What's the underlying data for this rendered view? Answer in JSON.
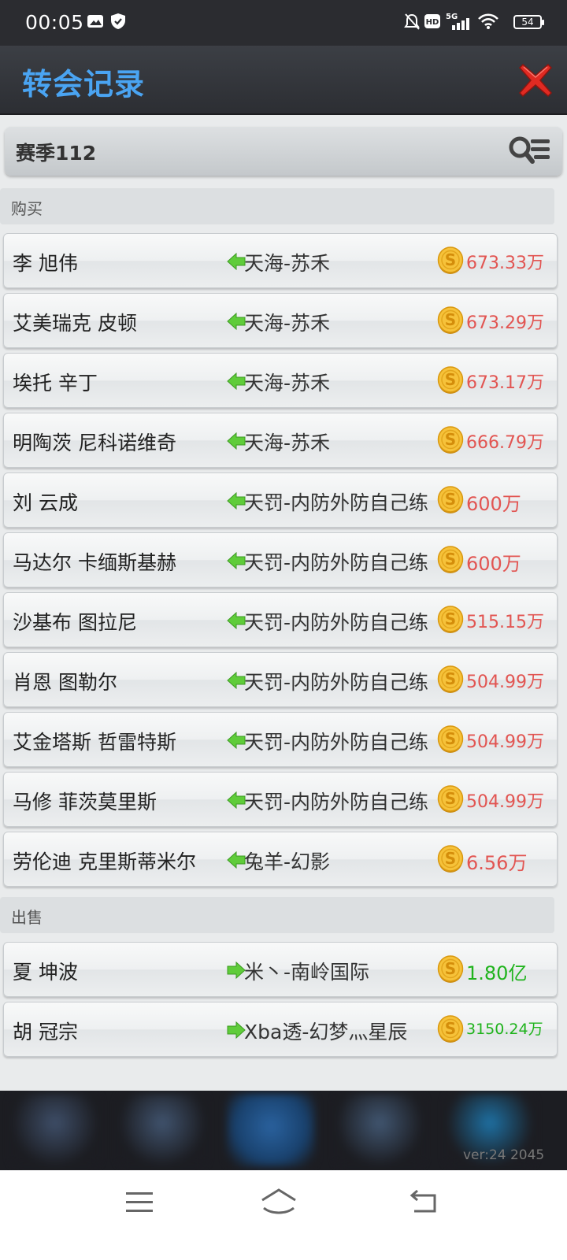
{
  "status_bar": {
    "time": "00:05",
    "battery": "54"
  },
  "header": {
    "title": "转会记录"
  },
  "season": {
    "label": "赛季112"
  },
  "buy_section": {
    "label": "购买",
    "rows": [
      {
        "player": "李 旭伟",
        "team": "天海-苏禾",
        "price": "673.33万"
      },
      {
        "player": "艾美瑞克 皮顿",
        "team": "天海-苏禾",
        "price": "673.29万"
      },
      {
        "player": "埃托 辛丁",
        "team": "天海-苏禾",
        "price": "673.17万"
      },
      {
        "player": "明陶茨 尼科诺维奇",
        "team": "天海-苏禾",
        "price": "666.79万"
      },
      {
        "player": "刘 云成",
        "team": "天罚-内防外防自己练",
        "price": "600万"
      },
      {
        "player": "马达尔 卡缅斯基赫",
        "team": "天罚-内防外防自己练",
        "price": "600万"
      },
      {
        "player": "沙基布 图拉尼",
        "team": "天罚-内防外防自己练",
        "price": "515.15万"
      },
      {
        "player": "肖恩 图勒尔",
        "team": "天罚-内防外防自己练",
        "price": "504.99万"
      },
      {
        "player": "艾金塔斯 哲雷特斯",
        "team": "天罚-内防外防自己练",
        "price": "504.99万"
      },
      {
        "player": "马修 菲茨莫里斯",
        "team": "天罚-内防外防自己练",
        "price": "504.99万"
      },
      {
        "player": "劳伦迪 克里斯蒂米尔",
        "team": "兔羊-幻影",
        "price": "6.56万"
      }
    ]
  },
  "sell_section": {
    "label": "出售",
    "rows": [
      {
        "player": "夏 坤波",
        "team": "米丶-南岭国际",
        "price": "1.80亿"
      },
      {
        "player": "胡 冠宗",
        "team": "Xba透-幻梦灬星辰",
        "price": "3150.24万"
      }
    ]
  },
  "bottom_bar": {
    "version": "ver:24  2045"
  },
  "colors": {
    "title_blue": "#4aa4f2",
    "buy_price": "#e25552",
    "sell_price": "#1fb31c",
    "arrow_green": "#5fcc3a"
  }
}
